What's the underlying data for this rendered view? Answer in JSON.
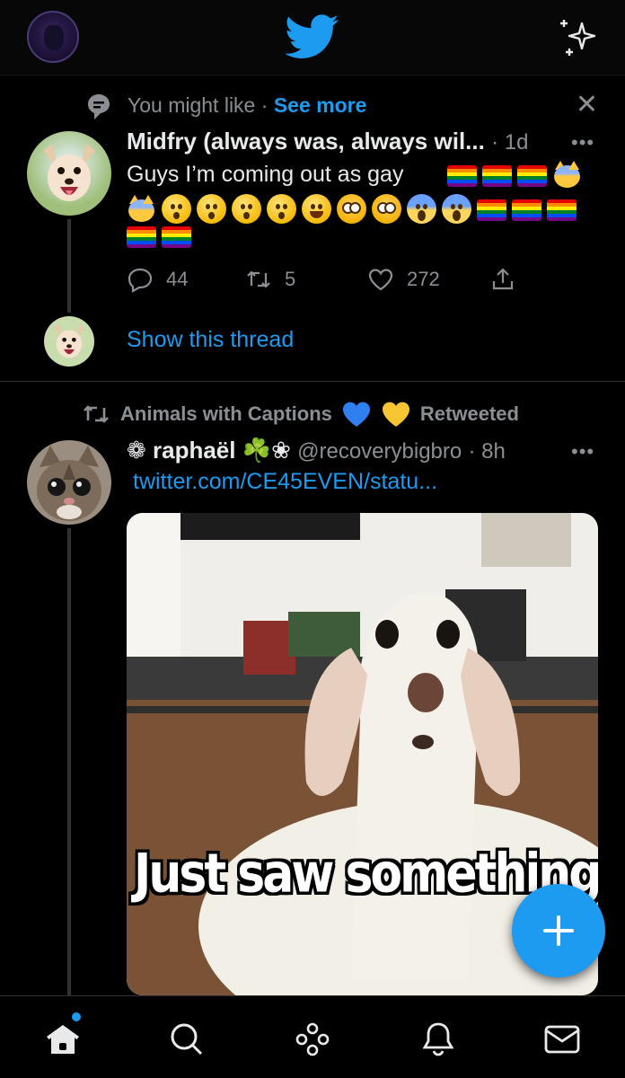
{
  "header": {
    "logo_icon": "twitter-bird-icon",
    "sparkle_icon": "sparkle-icon",
    "accent": "#1d9bf0"
  },
  "tweet1": {
    "context": "You might like",
    "separator": "·",
    "see_more": "See more",
    "author_name": "Midfry (always was, always wil...",
    "time": "· 1d",
    "text": "Guys I’m coming out as gay",
    "stats": {
      "replies": "44",
      "retweets": "5",
      "likes": "272"
    },
    "show_thread": "Show this thread"
  },
  "tweet2": {
    "retweeted_by": "Animals with Captions",
    "retweeted_label": "Retweeted",
    "author_name": "❁ raphaël ☘️❀",
    "handle": "@recoverybigbro",
    "time": "· 8h",
    "link": "twitter.com/CE45EVEN/statu...",
    "image_caption": "Just saw something lght"
  },
  "bottom_nav": {
    "items": [
      "home-icon",
      "search-icon",
      "spaces-icon",
      "notifications-icon",
      "messages-icon"
    ]
  }
}
